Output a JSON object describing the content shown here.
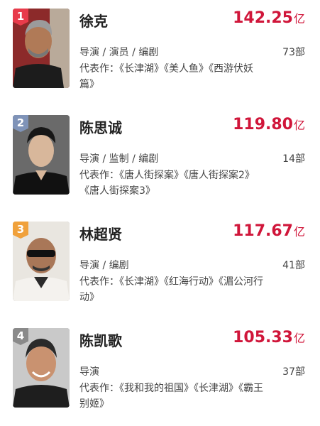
{
  "directors": [
    {
      "rank": "1",
      "rank_color": "#e83b4b",
      "name": "徐克",
      "box_office": "142.25",
      "unit": "亿",
      "roles": "导演 / 演员 / 编剧",
      "film_count": "73部",
      "works": "代表作：《长津湖》《美人鱼》《西游伏妖篇》"
    },
    {
      "rank": "2",
      "rank_color": "#7f93b8",
      "name": "陈思诚",
      "box_office": "119.80",
      "unit": "亿",
      "roles": "导演 / 监制 / 编剧",
      "film_count": "14部",
      "works": "代表作：《唐人街探案》《唐人街探案2》《唐人街探案3》"
    },
    {
      "rank": "3",
      "rank_color": "#f0a13b",
      "name": "林超贤",
      "box_office": "117.67",
      "unit": "亿",
      "roles": "导演 / 编剧",
      "film_count": "41部",
      "works": "代表作：《长津湖》《红海行动》《湄公河行动》"
    },
    {
      "rank": "4",
      "rank_color": "#8a8a8a",
      "name": "陈凯歌",
      "box_office": "105.33",
      "unit": "亿",
      "roles": "导演",
      "film_count": "37部",
      "works": "代表作：《我和我的祖国》《长津湖》《霸王别姬》"
    }
  ]
}
